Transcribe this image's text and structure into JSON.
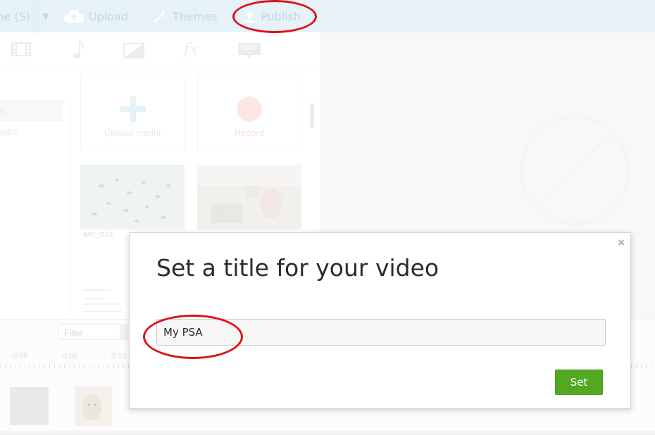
{
  "topbar": {
    "left_label": "me (S)",
    "upload_label": "Upload",
    "themes_label": "Themes",
    "publish_label": "Publish"
  },
  "media_tabs": [
    "film-icon",
    "music-note-icon",
    "transition-icon",
    "fx-icon",
    "text-icon"
  ],
  "fx_label": "fx",
  "text_tab_label": "TEXT",
  "sidebar": {
    "items": [
      {
        "label": "a"
      },
      {
        "label": "edia"
      }
    ]
  },
  "media": {
    "upload_label": "Upload media",
    "record_label": "Record",
    "thumbnails": [
      {
        "caption": "IMG_0153"
      }
    ]
  },
  "timeline": {
    "filter_placeholder": "Filter",
    "ticks": [
      "0:05",
      "0:10",
      "0:15"
    ]
  },
  "modal": {
    "title": "Set a title for your video",
    "input_value": "My PSA",
    "set_label": "Set",
    "close_label": "×"
  },
  "colors": {
    "topbar": "#d2e6f3",
    "accent_green": "#52a821",
    "annotation_red": "#d9141b"
  }
}
